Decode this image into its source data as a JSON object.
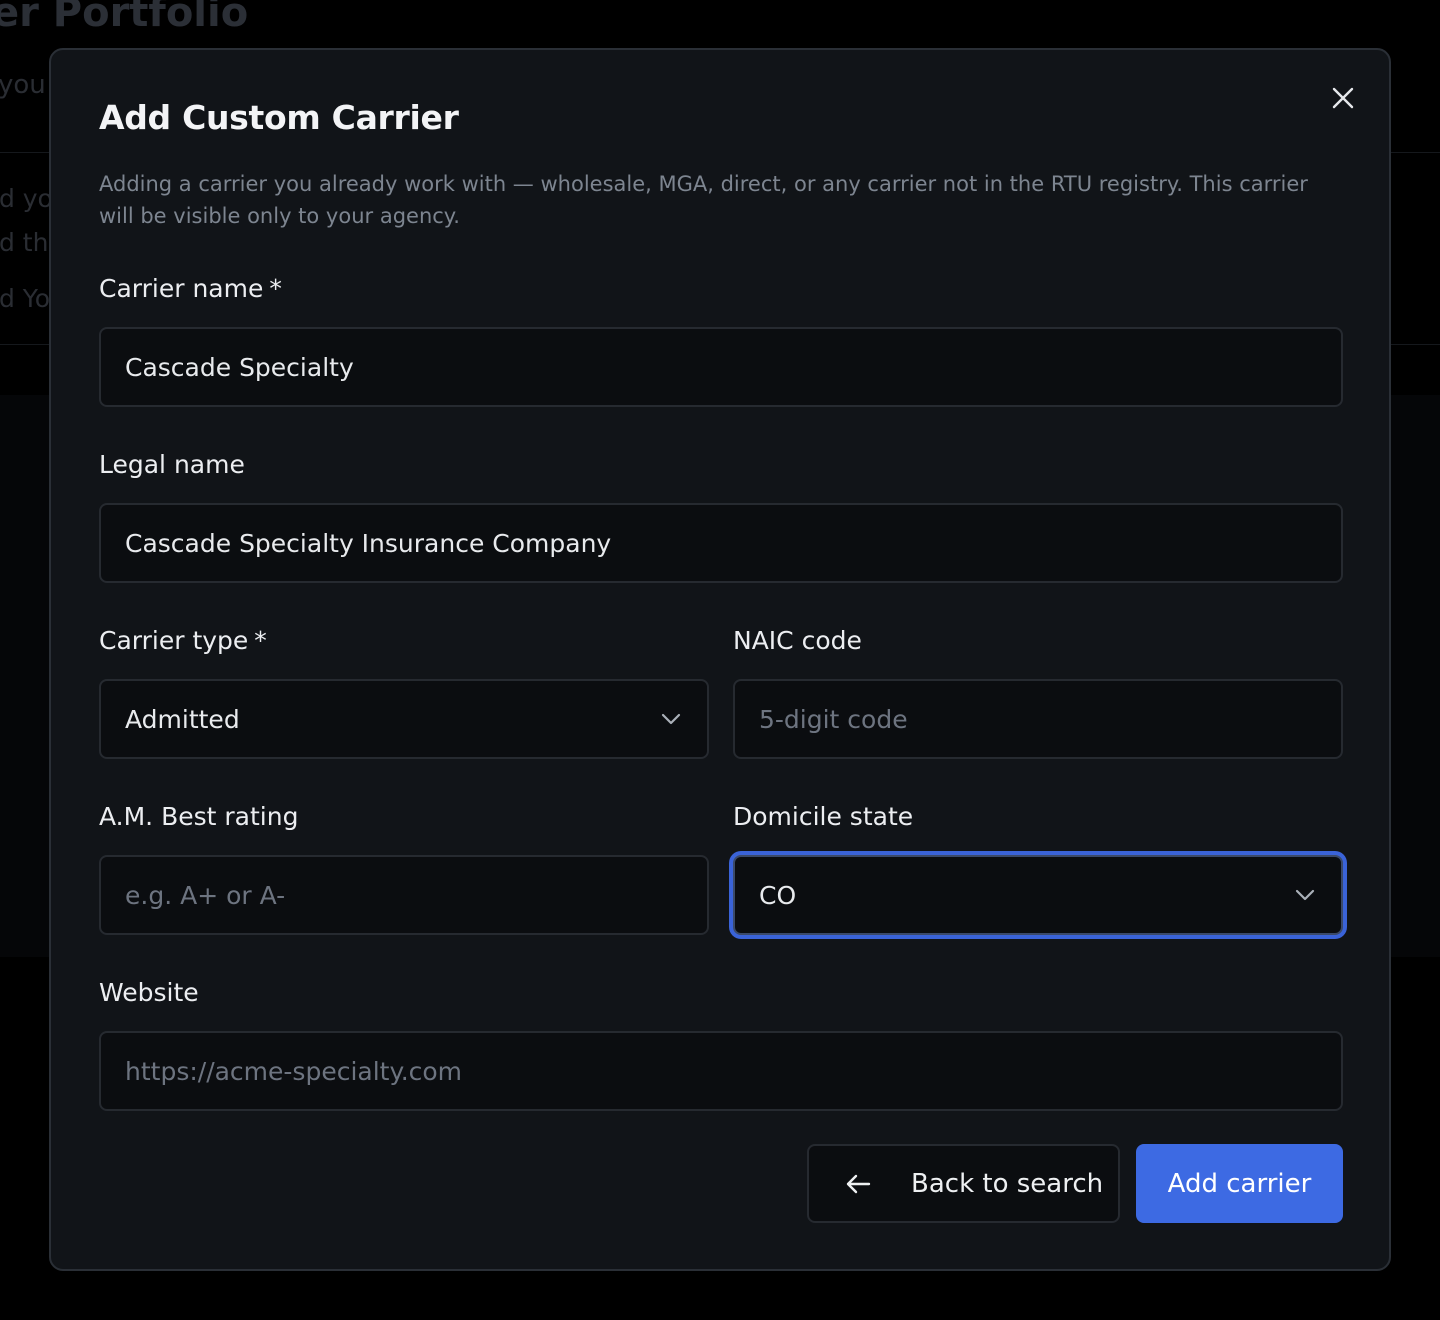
{
  "background": {
    "title": "er Portfolio",
    "subtitle": "you",
    "lines": [
      "ld yo",
      "ld th",
      "ld Yo"
    ]
  },
  "modal": {
    "title": "Add Custom Carrier",
    "description": "Adding a carrier you already work with — wholesale, MGA, direct, or any carrier not in the RTU registry. This carrier will be visible only to your agency.",
    "close_icon": "close-icon"
  },
  "fields": {
    "carrier_name": {
      "label": "Carrier name",
      "required_mark": "*",
      "value": "Cascade Specialty"
    },
    "legal_name": {
      "label": "Legal name",
      "value": "Cascade Specialty Insurance Company"
    },
    "carrier_type": {
      "label": "Carrier type",
      "required_mark": "*",
      "value": "Admitted",
      "icon": "chevron-down-icon"
    },
    "naic_code": {
      "label": "NAIC code",
      "value": "",
      "placeholder": "5-digit code"
    },
    "am_best": {
      "label": "A.M. Best rating",
      "value": "",
      "placeholder": "e.g. A+ or A-"
    },
    "domicile_state": {
      "label": "Domicile state",
      "value": "CO",
      "icon": "chevron-down-icon",
      "focused": true
    },
    "website": {
      "label": "Website",
      "value": "",
      "placeholder": "https://acme-specialty.com"
    }
  },
  "actions": {
    "back_label": "Back to search",
    "back_icon": "arrow-left-icon",
    "submit_label": "Add carrier"
  },
  "colors": {
    "accent": "#3d6ae3",
    "focus_ring": "#3a63d8",
    "modal_bg": "#111418",
    "input_bg": "#0b0d10"
  }
}
